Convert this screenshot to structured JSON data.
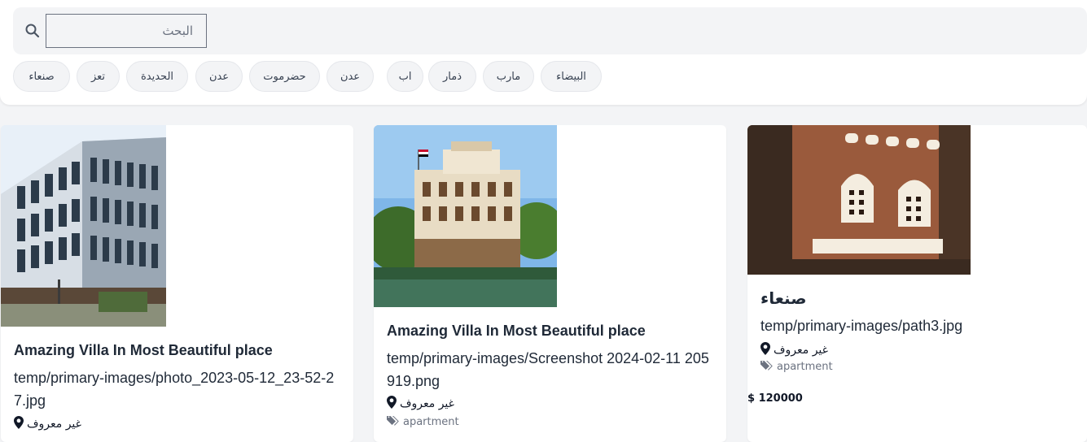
{
  "search": {
    "placeholder": "البحث"
  },
  "chips": [
    {
      "label": "البيضاء"
    },
    {
      "label": "مارب"
    },
    {
      "label": "ذمار"
    },
    {
      "label": "اب"
    },
    {
      "label": "عدن"
    },
    {
      "label": "حضرموت"
    },
    {
      "label": "عدن"
    },
    {
      "label": "الحديدة"
    },
    {
      "label": "تعز"
    },
    {
      "label": "صنعاء"
    }
  ],
  "cards": [
    {
      "title": "Amazing Villa In Most Beautiful place",
      "path": "temp/primary-images/photo_2023-05-12_23-52-27.jpg",
      "location": "غير معروف"
    },
    {
      "title": "Amazing Villa In Most Beautiful place",
      "path": "temp/primary-images/Screenshot 2024-02-11 205919.png",
      "location": "غير معروف",
      "tag": "apartment"
    },
    {
      "city": "صنعاء",
      "path": "temp/primary-images/path3.jpg",
      "location": "غير معروف",
      "tag": "apartment",
      "price": "$ 120000"
    }
  ],
  "colors": {
    "accent": "#111827",
    "muted": "#6b7280",
    "background": "#f3f4f6"
  }
}
